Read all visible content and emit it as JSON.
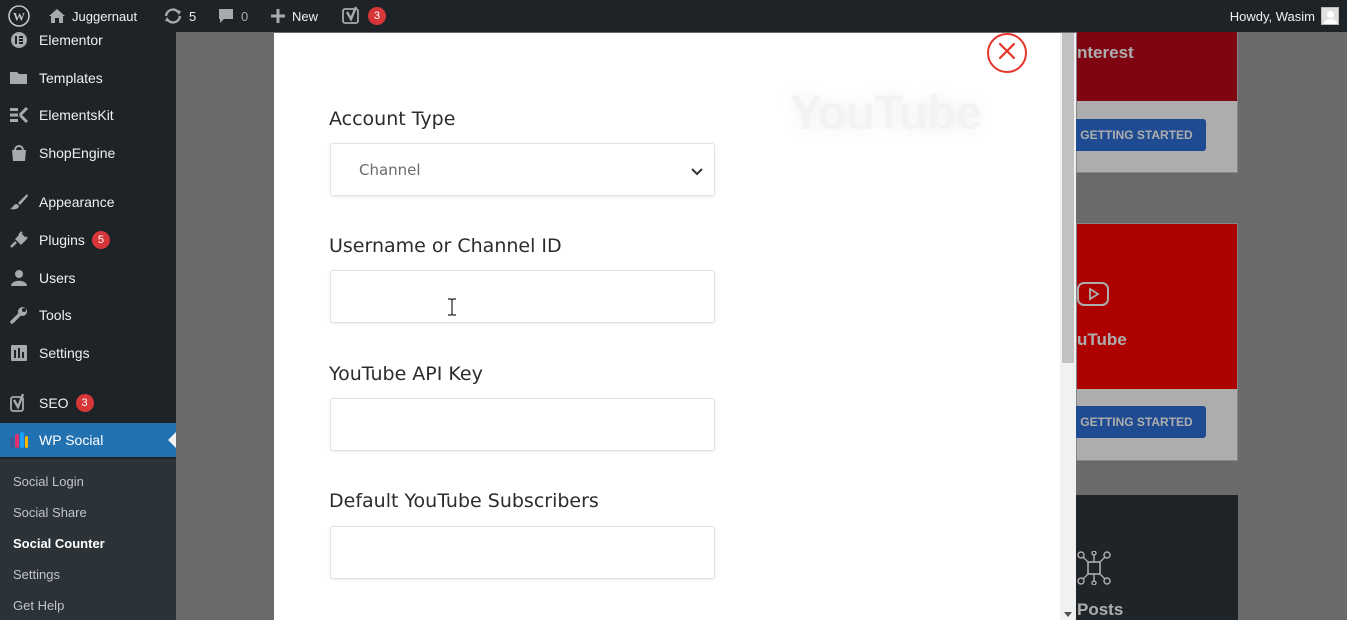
{
  "admin_bar": {
    "site_name": "Juggernaut",
    "updates_count": "5",
    "comments_count": "0",
    "new_label": "New",
    "seo_badge": "3",
    "howdy": "Howdy, Wasim"
  },
  "sidebar": {
    "items": [
      {
        "label": "Elementor",
        "icon": "elementor-icon"
      },
      {
        "label": "Templates",
        "icon": "folder-icon"
      },
      {
        "label": "ElementsKit",
        "icon": "elementskit-icon"
      },
      {
        "label": "ShopEngine",
        "icon": "shopengine-icon"
      },
      {
        "label": "Appearance",
        "icon": "brush-icon"
      },
      {
        "label": "Plugins",
        "icon": "plug-icon",
        "badge": "5"
      },
      {
        "label": "Users",
        "icon": "user-icon"
      },
      {
        "label": "Tools",
        "icon": "wrench-icon"
      },
      {
        "label": "Settings",
        "icon": "settings-icon"
      },
      {
        "label": "SEO",
        "icon": "yoast-icon",
        "badge": "3"
      },
      {
        "label": "WP Social",
        "icon": "wp-social-icon"
      }
    ],
    "submenu": [
      {
        "label": "Social Login"
      },
      {
        "label": "Social Share"
      },
      {
        "label": "Social Counter"
      },
      {
        "label": "Settings"
      },
      {
        "label": "Get Help"
      }
    ]
  },
  "background_cards": {
    "pinterest_title": "nterest",
    "youtube_title": "uTube",
    "posts_title": "Posts",
    "button_label": "GETTING STARTED"
  },
  "modal": {
    "watermark": "YouTube",
    "fields": [
      {
        "label": "Account Type",
        "value": "Channel"
      },
      {
        "label": "Username or Channel ID",
        "value": ""
      },
      {
        "label": "YouTube API Key",
        "value": ""
      },
      {
        "label": "Default YouTube Subscribers",
        "value": ""
      }
    ]
  },
  "colors": {
    "admin_bar_bg": "#1d2327",
    "active_menu": "#2271b1",
    "badge": "#d63638",
    "close_red": "#e5342b",
    "pinterest": "#bd081c",
    "youtube": "#ff0000",
    "button_blue": "#2f6fd7"
  }
}
